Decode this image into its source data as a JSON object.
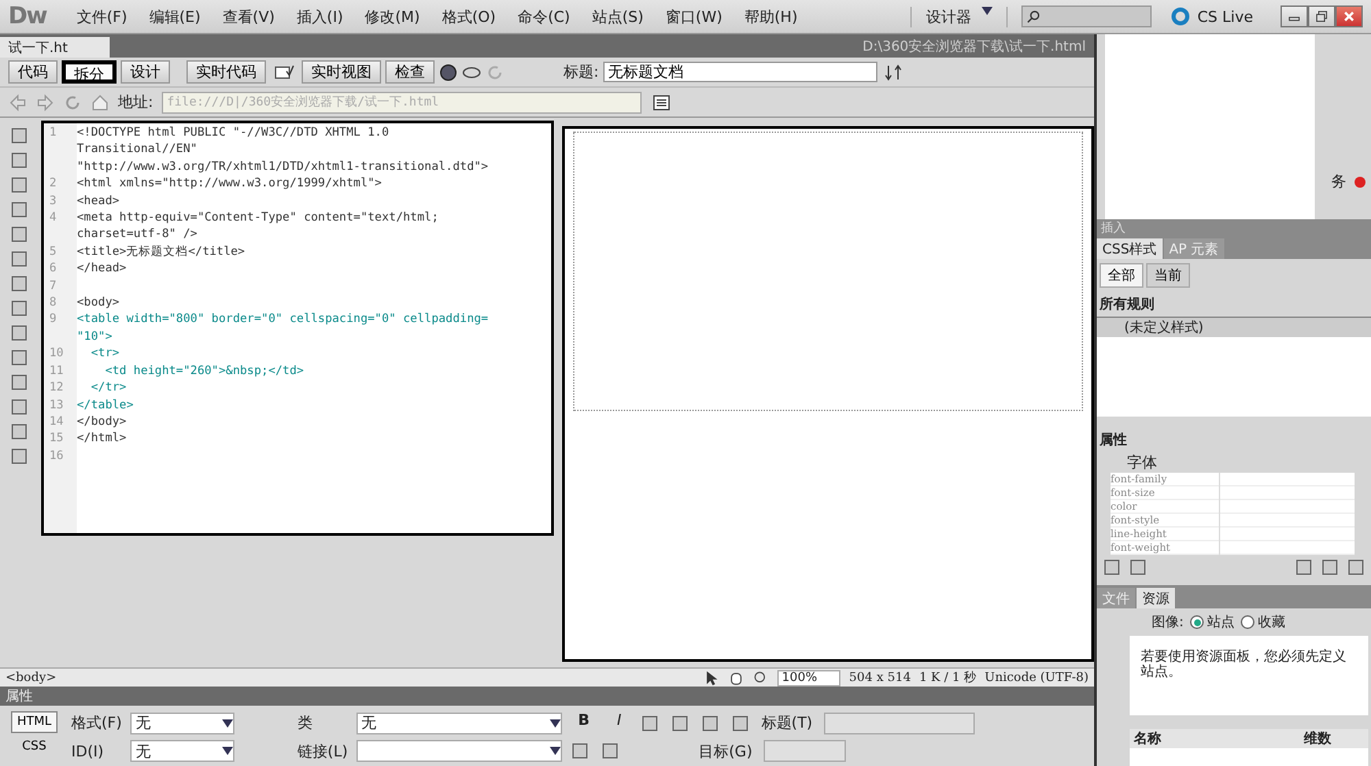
{
  "app": {
    "logo": "Dw",
    "menu": [
      "文件(F)",
      "编辑(E)",
      "查看(V)",
      "插入(I)",
      "修改(M)",
      "格式(O)",
      "命令(C)",
      "站点(S)",
      "窗口(W)",
      "帮助(H)"
    ],
    "workspace": "设计器",
    "cs_live": "CS Live"
  },
  "document_tab": {
    "label": "试一下.ht",
    "path": "D:\\360安全浏览器下载\\试一下.html"
  },
  "view_buttons": [
    {
      "label": "代码",
      "selected": false
    },
    {
      "label": "拆分",
      "selected": true
    },
    {
      "label": "设计",
      "selected": false
    }
  ],
  "live_buttons": [
    {
      "label": "实时代码",
      "kind": "button"
    },
    {
      "kind": "icon"
    },
    {
      "label": "实时视图",
      "kind": "button"
    },
    {
      "label": "检查",
      "kind": "button"
    }
  ],
  "title_field": {
    "label": "标题:",
    "value": "无标题文档"
  },
  "address": {
    "label": "地址:",
    "value": "file:///D|/360安全浏览器下载/试一下.html"
  },
  "code_lines": [
    {
      "number": "1",
      "kind": "tag",
      "parts": [
        "<!DOCTYPE html PUBLIC \"-//W3C//DTD XHTML 1.0",
        "Transitional//EN\"",
        "\"http://www.w3.org/TR/xhtml1/DTD/xhtml1-transitional.dtd\">"
      ]
    },
    {
      "number": "2",
      "kind": "tag",
      "parts": [
        "<html xmlns=\"http://www.w3.org/1999/xhtml\">"
      ]
    },
    {
      "number": "3",
      "kind": "tag",
      "parts": [
        "<head>"
      ]
    },
    {
      "number": "4",
      "kind": "tag",
      "parts": [
        "<meta http-equiv=\"Content-Type\" content=\"text/html;",
        "charset=utf-8\" />"
      ]
    },
    {
      "number": "5",
      "kind": "tag",
      "parts": [
        "<title>无标题文档</title>"
      ]
    },
    {
      "number": "6",
      "kind": "tag",
      "parts": [
        "</head>"
      ]
    },
    {
      "number": "7",
      "kind": "blank"
    },
    {
      "number": "8",
      "kind": "tag",
      "parts": [
        "<body>"
      ]
    },
    {
      "number": "9",
      "kind": "table",
      "parts": [
        "<table width=\"800\" border=\"0\" cellspacing=\"0\" cellpadding=",
        "\"10\">"
      ]
    },
    {
      "number": "10",
      "kind": "table",
      "parts": [
        "  <tr>"
      ]
    },
    {
      "number": "11",
      "kind": "table",
      "parts": [
        "    <td height=\"260\">&nbsp;</td>"
      ]
    },
    {
      "number": "12",
      "kind": "table",
      "parts": [
        "  </tr>"
      ]
    },
    {
      "number": "13",
      "kind": "table",
      "parts": [
        "</table>"
      ]
    },
    {
      "number": "14",
      "kind": "tag",
      "parts": [
        "</body>"
      ]
    },
    {
      "number": "15",
      "kind": "tag",
      "parts": [
        "</html>"
      ]
    },
    {
      "number": "16",
      "kind": "blank"
    }
  ],
  "status_bar": {
    "tag": "<body>",
    "zoom": "100%",
    "size": "504 x 514",
    "download": "1 K / 1 秒",
    "encoding": "Unicode (UTF-8)"
  },
  "properties": {
    "title": "属性",
    "modes": [
      {
        "label": "HTML",
        "selected": true
      },
      {
        "label": "CSS",
        "selected": false
      }
    ],
    "format_label": "格式(F)",
    "format_value": "无",
    "id_label": "ID(I)",
    "id_value": "无",
    "class_label": "类",
    "class_value": "无",
    "link_label": "链接(L)",
    "bold": "B",
    "italic": "I",
    "title_label": "标题(T)",
    "target_label": "目标(G)"
  },
  "side_top": {
    "text": "务"
  },
  "insert_header": "插入",
  "css_panel": {
    "tabs": [
      {
        "label": "CSS样式",
        "selected": true
      },
      {
        "label": "AP 元素",
        "selected": false
      }
    ],
    "modes": [
      {
        "label": "全部",
        "selected": true
      },
      {
        "label": "当前",
        "selected": false
      }
    ],
    "rules_header": "所有规则",
    "rules": [
      {
        "label": "(未定义样式)",
        "selected": true
      }
    ],
    "props_header": "属性",
    "group": "字体",
    "props": [
      "font-family",
      "font-size",
      "color",
      "font-style",
      "line-height",
      "font-weight"
    ]
  },
  "assets_panel": {
    "tabs": [
      {
        "label": "文件",
        "selected": false
      },
      {
        "label": "资源",
        "selected": true
      }
    ],
    "image_label": "图像:",
    "radios": [
      {
        "label": "站点",
        "selected": true
      },
      {
        "label": "收藏",
        "selected": false
      }
    ],
    "message": "若要使用资源面板，您必须先定义站点。",
    "columns": [
      "名称",
      "维数"
    ]
  }
}
